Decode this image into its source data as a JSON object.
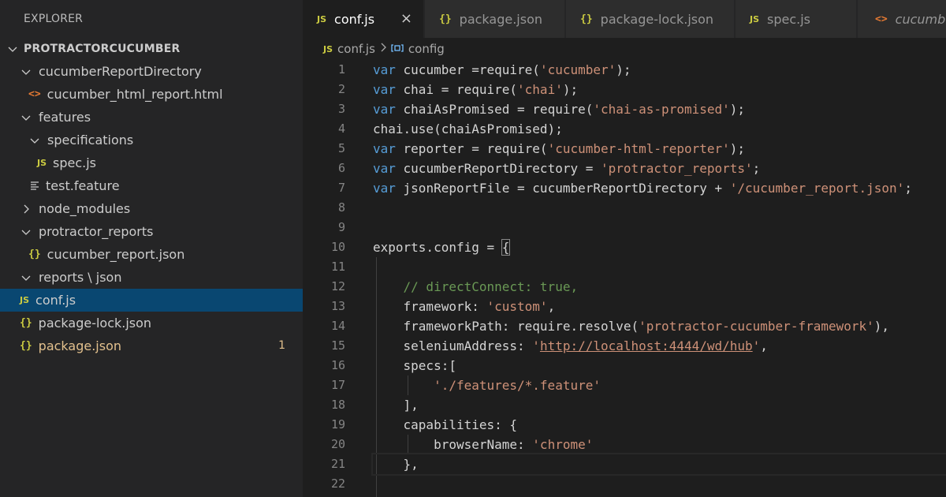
{
  "explorer": {
    "title": "EXPLORER",
    "root": "PROTRACTORCUCUMBER",
    "items": [
      {
        "label": "cucumberReportDirectory",
        "type": "folder",
        "open": true
      },
      {
        "label": "cucumber_html_report.html",
        "type": "html"
      },
      {
        "label": "features",
        "type": "folder",
        "open": true
      },
      {
        "label": "specifications",
        "type": "folder",
        "open": true
      },
      {
        "label": "spec.js",
        "type": "js"
      },
      {
        "label": "test.feature",
        "type": "feature"
      },
      {
        "label": "node_modules",
        "type": "folder",
        "open": false
      },
      {
        "label": "protractor_reports",
        "type": "folder",
        "open": true
      },
      {
        "label": "cucumber_report.json",
        "type": "json"
      },
      {
        "label": "reports \\ json",
        "type": "folder",
        "open": true
      },
      {
        "label": "conf.js",
        "type": "js",
        "selected": true
      },
      {
        "label": "package-lock.json",
        "type": "json"
      },
      {
        "label": "package.json",
        "type": "json",
        "badge": "1",
        "modified": true
      }
    ]
  },
  "tabs": [
    {
      "label": "conf.js",
      "icon": "JS",
      "active": true,
      "close": "×"
    },
    {
      "label": "package.json",
      "icon": "{}"
    },
    {
      "label": "package-lock.json",
      "icon": "{}"
    },
    {
      "label": "spec.js",
      "icon": "JS"
    },
    {
      "label": "cucumbe",
      "icon": "<>"
    }
  ],
  "breadcrumb": {
    "file": "conf.js",
    "icon": "JS",
    "symbol": "config"
  },
  "editor": {
    "line_numbers": [
      "1",
      "2",
      "3",
      "4",
      "5",
      "6",
      "7",
      "8",
      "9",
      "10",
      "11",
      "12",
      "13",
      "14",
      "15",
      "16",
      "17",
      "18",
      "19",
      "20",
      "21",
      "22"
    ],
    "lines": [
      [
        [
          "k",
          "var"
        ],
        [
          "p",
          " cucumber ="
        ],
        [
          "p",
          "require("
        ],
        [
          "s",
          "'cucumber'"
        ],
        [
          "p",
          ");"
        ]
      ],
      [
        [
          "k",
          "var"
        ],
        [
          "p",
          " chai = require("
        ],
        [
          "s",
          "'chai'"
        ],
        [
          "p",
          ");"
        ]
      ],
      [
        [
          "k",
          "var"
        ],
        [
          "p",
          " chaiAsPromised = require("
        ],
        [
          "s",
          "'chai-as-promised'"
        ],
        [
          "p",
          ");"
        ]
      ],
      [
        [
          "p",
          "chai.use(chaiAsPromised);"
        ]
      ],
      [
        [
          "k",
          "var"
        ],
        [
          "p",
          " reporter = require("
        ],
        [
          "s",
          "'cucumber-html-reporter'"
        ],
        [
          "p",
          ");"
        ]
      ],
      [
        [
          "k",
          "var"
        ],
        [
          "p",
          " cucumberReportDirectory = "
        ],
        [
          "s",
          "'protractor_reports'"
        ],
        [
          "p",
          ";"
        ]
      ],
      [
        [
          "k",
          "var"
        ],
        [
          "p",
          " jsonReportFile = cucumberReportDirectory + "
        ],
        [
          "s",
          "'/cucumber_report.json'"
        ],
        [
          "p",
          ";"
        ]
      ],
      [],
      [],
      [
        [
          "p",
          "exports.config = "
        ],
        [
          "p",
          "{"
        ]
      ],
      [],
      [
        [
          "p",
          "    "
        ],
        [
          "c",
          "// directConnect: true,"
        ]
      ],
      [
        [
          "p",
          "    framework: "
        ],
        [
          "s",
          "'custom'"
        ],
        [
          "p",
          ","
        ]
      ],
      [
        [
          "p",
          "    frameworkPath: require.resolve("
        ],
        [
          "s",
          "'protractor-cucumber-framework'"
        ],
        [
          "p",
          "),"
        ]
      ],
      [
        [
          "p",
          "    seleniumAddress: "
        ],
        [
          "s",
          "'"
        ],
        [
          "su",
          "http://localhost:4444/wd/hub"
        ],
        [
          "s",
          "'"
        ],
        [
          "p",
          ","
        ]
      ],
      [
        [
          "p",
          "    specs:["
        ]
      ],
      [
        [
          "p",
          "        "
        ],
        [
          "s",
          "'./features/*.feature'"
        ]
      ],
      [
        [
          "p",
          "    ],"
        ]
      ],
      [
        [
          "p",
          "    capabilities: {"
        ]
      ],
      [
        [
          "p",
          "        browserName: "
        ],
        [
          "s",
          "'chrome'"
        ]
      ],
      [
        [
          "p",
          "    },"
        ]
      ],
      []
    ]
  }
}
